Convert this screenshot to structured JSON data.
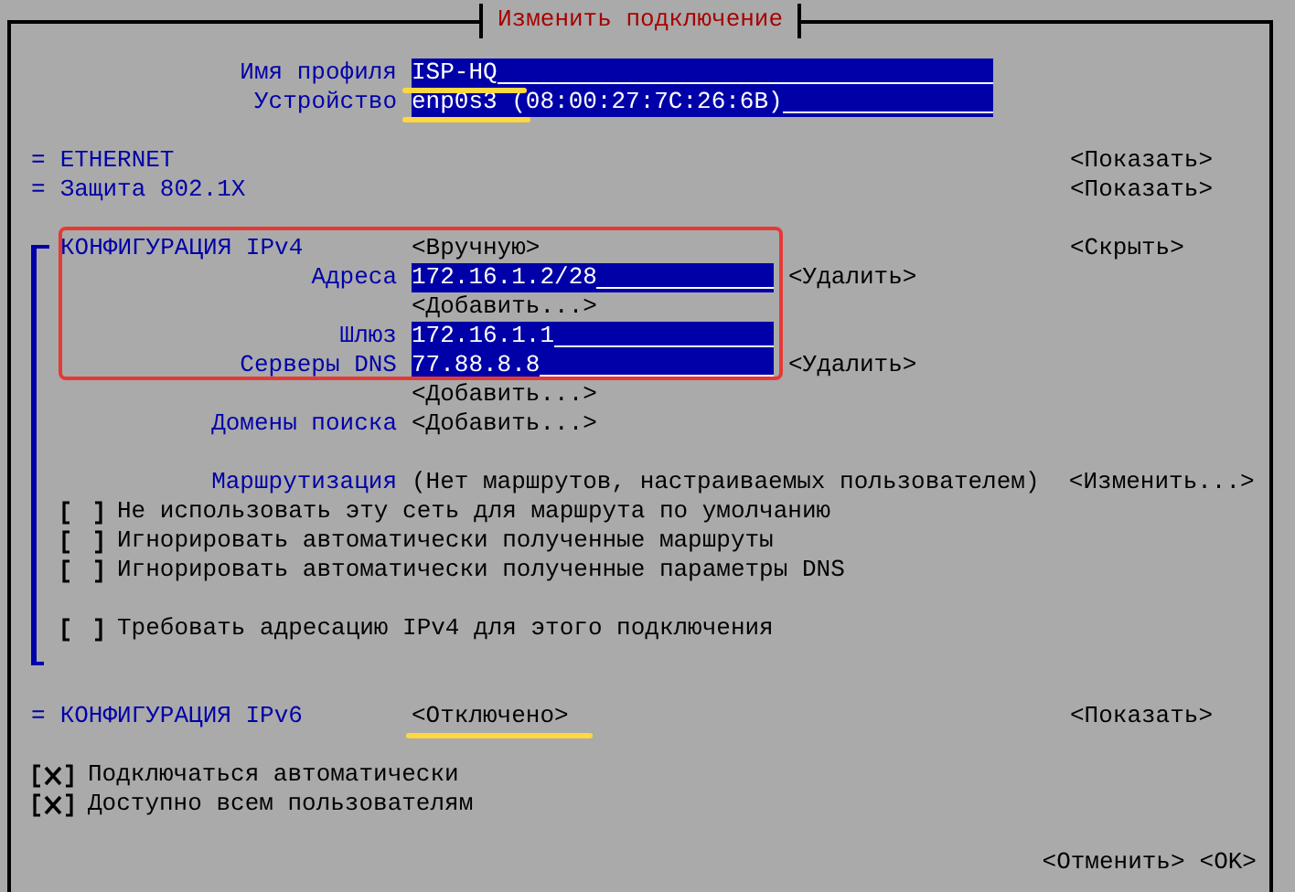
{
  "window": {
    "title": "Изменить подключение"
  },
  "profile": [
    {
      "label": "Имя профиля",
      "value": "ISP-HQ",
      "underlined": true
    },
    {
      "label": "Устройство",
      "value": "enp0s3 (08:00:27:7C:26:6B)",
      "underlined": true
    }
  ],
  "sections": [
    {
      "marker": "=",
      "title": "ETHERNET",
      "toggle": "<Показать>",
      "expanded": false
    },
    {
      "marker": "=",
      "title": "Защита 802.1X",
      "toggle": "<Показать>",
      "expanded": false
    }
  ],
  "ipv4": {
    "title": "КОНФИГУРАЦИЯ IPv4",
    "mode": "<Вручную>",
    "toggle": "<Скрыть>",
    "expanded": true,
    "highlighted": true,
    "rows": [
      {
        "kind": "field",
        "label": "Адреса",
        "value": "172.16.1.2/28",
        "action": "<Удалить>"
      },
      {
        "kind": "button",
        "label": "<Добавить...>"
      },
      {
        "kind": "field",
        "label": "Шлюз",
        "value": "172.16.1.1"
      },
      {
        "kind": "field",
        "label": "Серверы DNS",
        "value": "77.88.8.8",
        "action": "<Удалить>"
      },
      {
        "kind": "button",
        "label": "<Добавить...>"
      },
      {
        "kind": "labeled-button",
        "label": "Домены поиска",
        "button": "<Добавить...>"
      }
    ],
    "routing": {
      "label": "Маршрутизация",
      "summary": "(Нет маршрутов, настраиваемых пользователем)",
      "button": "<Изменить...>"
    },
    "options": [
      {
        "label": "Не использовать эту сеть для маршрута по умолчанию",
        "checked": false
      },
      {
        "label": "Игнорировать автоматически полученные маршруты",
        "checked": false
      },
      {
        "label": "Игнорировать автоматически полученные параметры DNS",
        "checked": false
      }
    ],
    "require": {
      "label": "Требовать адресацию IPv4 для этого подключения",
      "checked": false
    }
  },
  "ipv6": {
    "marker": "=",
    "title": "КОНФИГУРАЦИЯ IPv6",
    "mode": "<Отключено>",
    "mode_underlined": true,
    "toggle": "<Показать>",
    "expanded": false
  },
  "options": [
    {
      "label": "Подключаться автоматически",
      "checked": true
    },
    {
      "label": "Доступно всем пользователям",
      "checked": true
    }
  ],
  "buttons": [
    "<Отменить>",
    "<OK>"
  ]
}
